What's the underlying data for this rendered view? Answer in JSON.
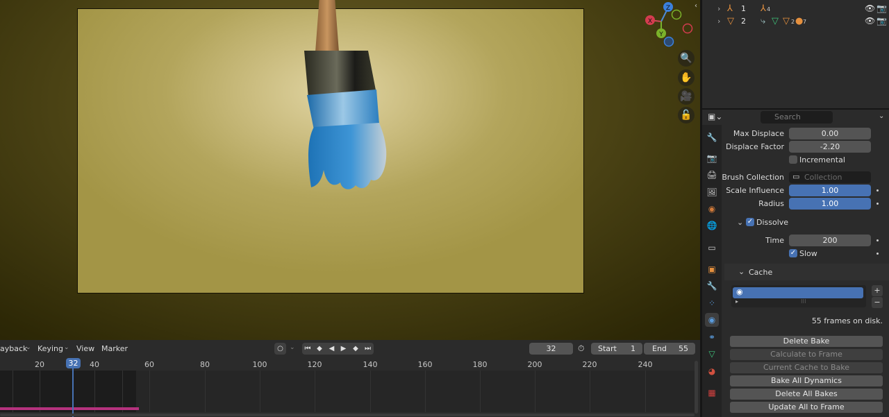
{
  "viewport": {
    "gizmo": {
      "x": "X",
      "y": "Y",
      "z": "Z"
    },
    "nav_icons": [
      "zoom-icon",
      "hand-icon",
      "camera-icon",
      "lock-icon"
    ]
  },
  "outliner": {
    "rows": [
      {
        "number": "1",
        "subscript": "4"
      },
      {
        "number": "2",
        "subscript_a": "2",
        "subscript_b": "7"
      }
    ]
  },
  "properties": {
    "search_placeholder": "Search",
    "max_displace_label": "Max Displace",
    "max_displace_value": "0.00",
    "displace_factor_label": "Displace Factor",
    "displace_factor_value": "-2.20",
    "incremental_label": "Incremental",
    "brush_collection_label": "Brush Collection",
    "brush_collection_placeholder": "Collection",
    "scale_influence_label": "Scale Influence",
    "scale_influence_value": "1.00",
    "radius_label": "Radius",
    "radius_value": "1.00",
    "dissolve_label": "Dissolve",
    "time_label": "Time",
    "time_value": "200",
    "slow_label": "Slow",
    "cache_label": "Cache",
    "cache_info": "55 frames on disk.",
    "buttons": {
      "delete_bake": "Delete Bake",
      "calculate_to_frame": "Calculate to Frame",
      "current_cache_to_bake": "Current Cache to Bake",
      "bake_all_dynamics": "Bake All Dynamics",
      "delete_all_bakes": "Delete All Bakes",
      "update_all_to_frame": "Update All to Frame"
    },
    "list_add": "+",
    "list_remove": "−"
  },
  "timeline": {
    "menus": {
      "playback": "ayback",
      "keying": "Keying",
      "view": "View",
      "marker": "Marker"
    },
    "current_frame": "32",
    "start_label": "Start",
    "start_value": "1",
    "end_label": "End",
    "end_value": "55",
    "ruler_labels": [
      "20",
      "40",
      "60",
      "80",
      "100",
      "120",
      "140",
      "160",
      "180",
      "200",
      "220",
      "240"
    ],
    "playhead_frame": "32"
  },
  "colors": {
    "accent": "#4772b3",
    "cache_bar": "#b5327e",
    "brush_blue": "#2d7fc0"
  }
}
